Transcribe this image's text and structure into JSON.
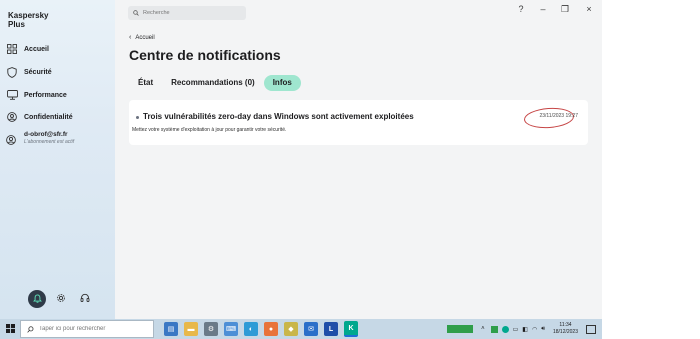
{
  "app": {
    "brand_line1": "Kaspersky",
    "brand_line2": "Plus"
  },
  "sidebar": {
    "items": [
      {
        "label": "Accueil",
        "icon": "home-grid-icon"
      },
      {
        "label": "Sécurité",
        "icon": "shield-icon"
      },
      {
        "label": "Performance",
        "icon": "monitor-icon"
      },
      {
        "label": "Confidentialité",
        "icon": "privacy-icon"
      }
    ],
    "account": {
      "email": "d-obrof@sfr.fr",
      "status": "L'abonnement est actif"
    }
  },
  "search": {
    "placeholder": "Recherche"
  },
  "window": {
    "help": "?",
    "minimize": "–",
    "restore": "❐",
    "close": "×"
  },
  "breadcrumb": {
    "back_label": "Accueil"
  },
  "page": {
    "title": "Centre de notifications",
    "tabs": [
      {
        "label": "État",
        "active": false
      },
      {
        "label": "Recommandations (0)",
        "active": false
      },
      {
        "label": "Infos",
        "active": true
      }
    ]
  },
  "notification": {
    "headline": "Trois vulnérabilités zero-day dans Windows sont activement exploitées",
    "description": "Mettez votre système d'exploitation à jour pour garantir votre sécurité.",
    "timestamp": "23/11/2023 19:27"
  },
  "taskbar": {
    "search_placeholder": "Taper ici pour rechercher",
    "time": "11:34",
    "date": "18/12/2023"
  },
  "colors": {
    "accent_tab": "#9fe6cf",
    "sidebar": "#dfeaf4",
    "kaspersky_green": "#00a88e"
  }
}
